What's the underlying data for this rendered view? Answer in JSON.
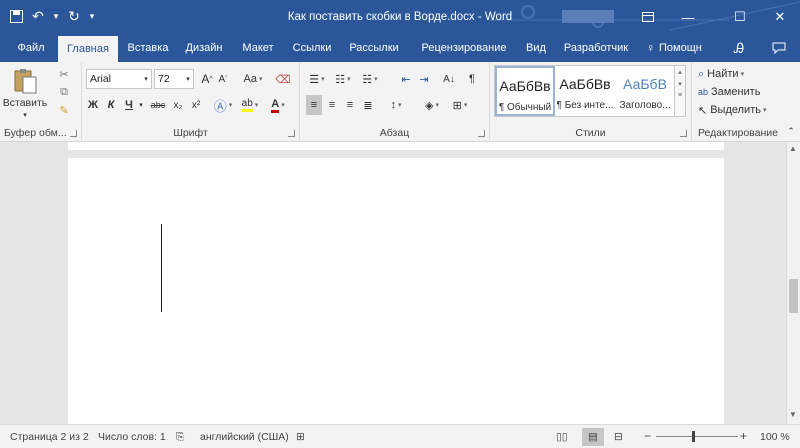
{
  "title": "Как поставить скобки в Ворде.docx - Word",
  "window": {
    "restore_icon": "ribbon-display-icon",
    "minimize": "—",
    "maximize": "☐",
    "close": "✕"
  },
  "tabs": [
    {
      "label": "Файл"
    },
    {
      "label": "Главная",
      "active": true
    },
    {
      "label": "Вставка"
    },
    {
      "label": "Дизайн"
    },
    {
      "label": "Макет"
    },
    {
      "label": "Ссылки"
    },
    {
      "label": "Рассылки"
    },
    {
      "label": "Рецензирование"
    },
    {
      "label": "Вид"
    },
    {
      "label": "Разработчик"
    }
  ],
  "help": "Помощн",
  "ribbon": {
    "clipboard": {
      "paste": "Вставить",
      "label": "Буфер обм..."
    },
    "font": {
      "name": "Arial",
      "size": "72",
      "label": "Шрифт",
      "bold": "Ж",
      "italic": "К",
      "underline": "Ч",
      "strike": "abc",
      "sub": "x₂",
      "sup": "x²",
      "grow": "A",
      "shrink": "A",
      "case": "Aa"
    },
    "paragraph": {
      "label": "Абзац",
      "sort": "А↓",
      "marks": "¶"
    },
    "styles": {
      "label": "Стили",
      "items": [
        {
          "sample": "АаБбВв",
          "name": "¶ Обычный"
        },
        {
          "sample": "АаБбВв",
          "name": "¶ Без инте..."
        },
        {
          "sample": "АаБбВ",
          "name": "Заголово..."
        }
      ]
    },
    "editing": {
      "label": "Редактирование",
      "find": "Найти",
      "replace": "Заменить",
      "select": "Выделить"
    }
  },
  "status": {
    "page": "Страница 2 из 2",
    "words": "Число слов: 1",
    "language": "английский (США)",
    "zoom": "100 %",
    "zoom_minus": "−",
    "zoom_plus": "+"
  },
  "colors": {
    "accent": "#2b579a",
    "ribbon_bg": "#f3f3f3"
  }
}
